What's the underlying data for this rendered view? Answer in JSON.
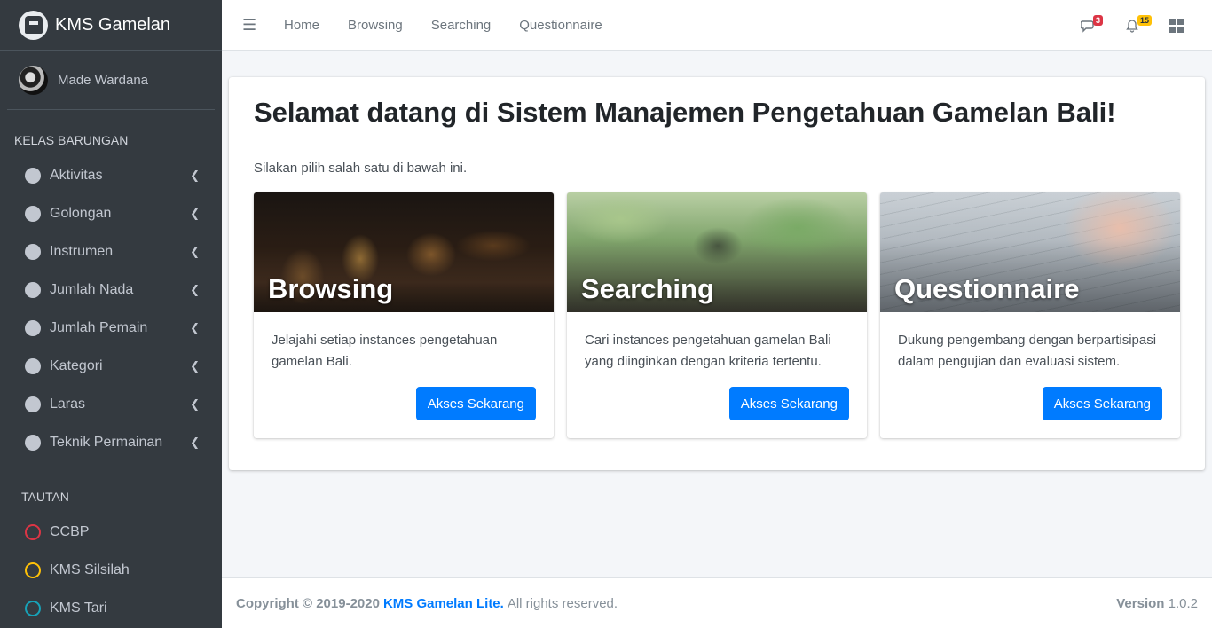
{
  "brand": {
    "name": "KMS Gamelan"
  },
  "user": {
    "name": "Made Wardana"
  },
  "sidebar": {
    "section_kelas": "KELAS BARUNGAN",
    "items": [
      {
        "label": "Aktivitas"
      },
      {
        "label": "Golongan"
      },
      {
        "label": "Instrumen"
      },
      {
        "label": "Jumlah Nada"
      },
      {
        "label": "Jumlah Pemain"
      },
      {
        "label": "Kategori"
      },
      {
        "label": "Laras"
      },
      {
        "label": "Teknik Permainan"
      }
    ],
    "section_tautan": "TAUTAN",
    "links": [
      {
        "label": "CCBP",
        "color": "#dc3545"
      },
      {
        "label": "KMS Silsilah",
        "color": "#ffc107"
      },
      {
        "label": "KMS Tari",
        "color": "#17a2b8"
      }
    ]
  },
  "topnav": {
    "links": [
      "Home",
      "Browsing",
      "Searching",
      "Questionnaire"
    ],
    "messages_count": "3",
    "notifications_count": "15",
    "icons": {
      "menu": "hamburger-icon",
      "messages": "comments-icon",
      "notifications": "bell-icon",
      "apps": "grid-icon"
    }
  },
  "main": {
    "title": "Selamat datang di Sistem Manajemen Pengetahuan Gamelan Bali!",
    "subtitle": "Silakan pilih salah satu di bawah ini.",
    "cards": [
      {
        "title": "Browsing",
        "desc": "Jelajahi setiap instances pengetahuan gamelan Bali.",
        "button": "Akses Sekarang"
      },
      {
        "title": "Searching",
        "desc": "Cari instances pengetahuan gamelan Bali yang diinginkan dengan kriteria tertentu.",
        "button": "Akses Sekarang"
      },
      {
        "title": "Questionnaire",
        "desc": "Dukung pengembang dengan berpartisipasi dalam pengujian dan evaluasi sistem.",
        "button": "Akses Sekarang"
      }
    ]
  },
  "footer": {
    "copyright": "Copyright © 2019-2020",
    "product": "KMS Gamelan Lite.",
    "rights": "All rights reserved.",
    "version_label": "Version",
    "version_value": "1.0.2"
  },
  "colors": {
    "sidebar_bg": "#343a40",
    "primary": "#007bff",
    "body_bg": "#f4f6f9"
  }
}
